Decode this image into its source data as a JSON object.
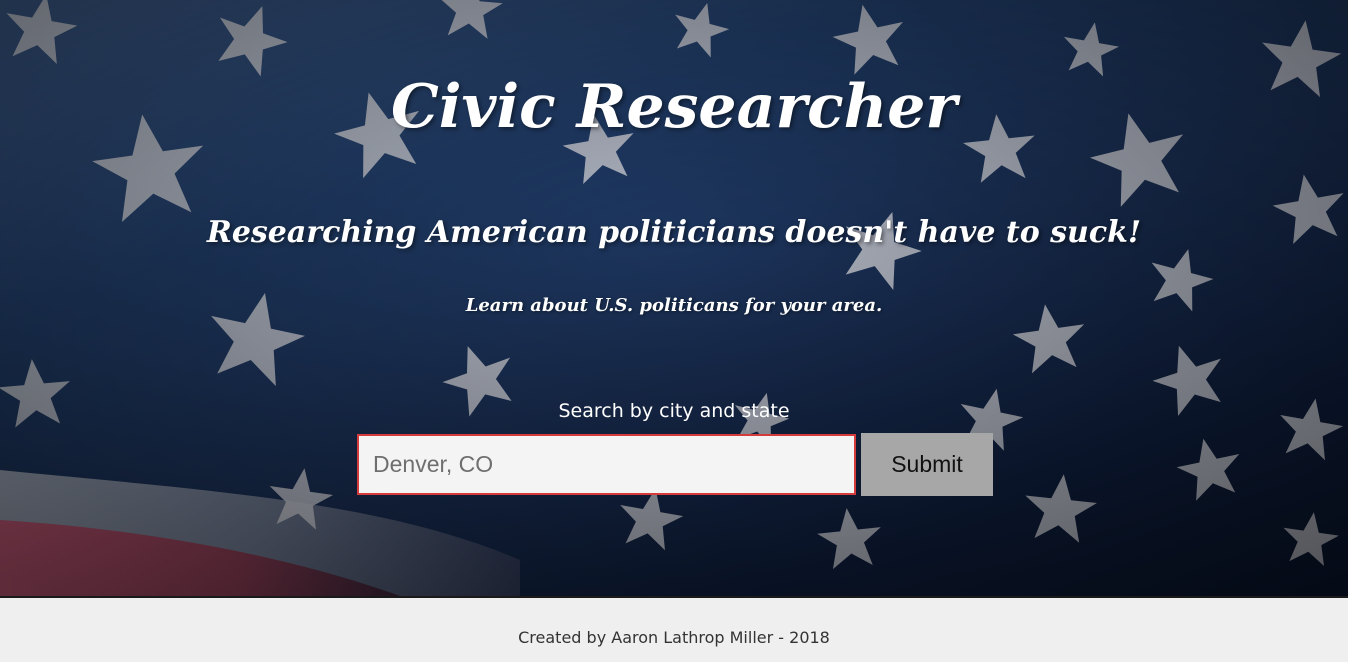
{
  "hero": {
    "title": "Civic Researcher",
    "tagline": "Researching American politicians doesn't have to suck!",
    "subtitle": "Learn about U.S. politicans for your area.",
    "background": "american-flag-image"
  },
  "search": {
    "label": "Search by city and state",
    "placeholder": "Denver, CO",
    "value": "",
    "submit_label": "Submit"
  },
  "footer": {
    "text": "Created by Aaron Lathrop Miller - 2018"
  },
  "colors": {
    "input_border": "#d63b3b",
    "button_bg": "#a7a7a7",
    "footer_bg": "#efefef",
    "flag_blue": "#1b3158",
    "flag_red": "#c95068"
  }
}
